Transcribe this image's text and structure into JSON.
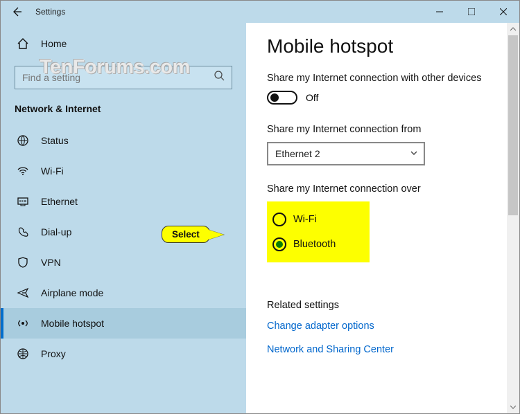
{
  "titlebar": {
    "title": "Settings"
  },
  "watermark": "TenForums.com",
  "sidebar": {
    "home": "Home",
    "search_placeholder": "Find a setting",
    "section": "Network & Internet",
    "items": [
      {
        "label": "Status"
      },
      {
        "label": "Wi-Fi"
      },
      {
        "label": "Ethernet"
      },
      {
        "label": "Dial-up"
      },
      {
        "label": "VPN"
      },
      {
        "label": "Airplane mode"
      },
      {
        "label": "Mobile hotspot"
      },
      {
        "label": "Proxy"
      }
    ]
  },
  "main": {
    "heading": "Mobile hotspot",
    "share_with_label": "Share my Internet connection with other devices",
    "toggle_state": "Off",
    "share_from_label": "Share my Internet connection from",
    "share_from_value": "Ethernet 2",
    "share_over_label": "Share my Internet connection over",
    "radio": {
      "wifi": "Wi-Fi",
      "bluetooth": "Bluetooth"
    },
    "related_header": "Related settings",
    "link1": "Change adapter options",
    "link2": "Network and Sharing Center"
  },
  "callout": "Select"
}
